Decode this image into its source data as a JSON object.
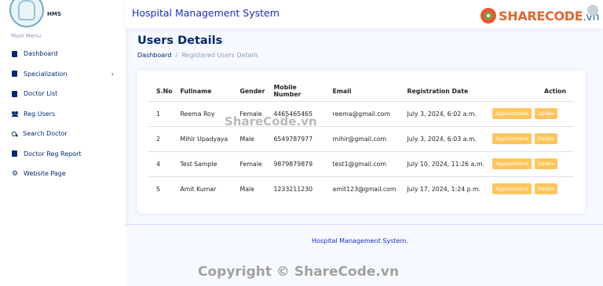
{
  "sidebar": {
    "brand": "HMS",
    "menu_heading": "Main Menu",
    "items": [
      {
        "label": "Dashboard",
        "icon": "file-icon"
      },
      {
        "label": "Specialization",
        "icon": "file-icon",
        "has_children": true
      },
      {
        "label": "Doctor List",
        "icon": "file-icon"
      },
      {
        "label": "Reg Users",
        "icon": "people-icon"
      },
      {
        "label": "Search Doctor",
        "icon": "search-icon"
      },
      {
        "label": "Doctor Reg Report",
        "icon": "file-icon"
      },
      {
        "label": "Website Page",
        "icon": "gear-icon"
      }
    ]
  },
  "header": {
    "title": "Hospital Management System",
    "watermark_logo": "SHARECODE",
    "watermark_logo_suffix": ".vn"
  },
  "main": {
    "page_title": "Users Details",
    "breadcrumb": [
      "Dashboard",
      "/",
      "Registered Users Details"
    ],
    "table": {
      "columns": [
        "S.No",
        "Fullname",
        "Gender",
        "Mobile Number",
        "Email",
        "Registration Date",
        "Action"
      ],
      "rows": [
        {
          "sno": "1",
          "name": "Reema Roy",
          "gender": "Female",
          "mobile": "4465465465",
          "email": "reema@gmail.com",
          "date": "July 3, 2024, 6:02 a.m."
        },
        {
          "sno": "2",
          "name": "Mihir Upadyaya",
          "gender": "Male",
          "mobile": "6549787977",
          "email": "mihir@gmail.com",
          "date": "July 3, 2024, 6:03 a.m."
        },
        {
          "sno": "4",
          "name": "Test Sample",
          "gender": "Female",
          "mobile": "9879879879",
          "email": "test1@gmail.com",
          "date": "July 10, 2024, 11:26 a.m."
        },
        {
          "sno": "5",
          "name": "Amit Kumar",
          "gender": "Male",
          "mobile": "1233211230",
          "email": "amit123@gmail.com",
          "date": "July 17, 2024, 1:24 p.m."
        }
      ],
      "appointment_label": "Appointment",
      "delete_label": "Delete"
    }
  },
  "footer": {
    "text": "Hospital Management System."
  },
  "watermarks": {
    "center": "ShareCode.vn",
    "bottom": "Copyright © ShareCode.vn"
  },
  "colors": {
    "primary": "#012970",
    "accent": "#4154f1",
    "button": "#ffc55c",
    "header_title": "#1b2ec5"
  }
}
